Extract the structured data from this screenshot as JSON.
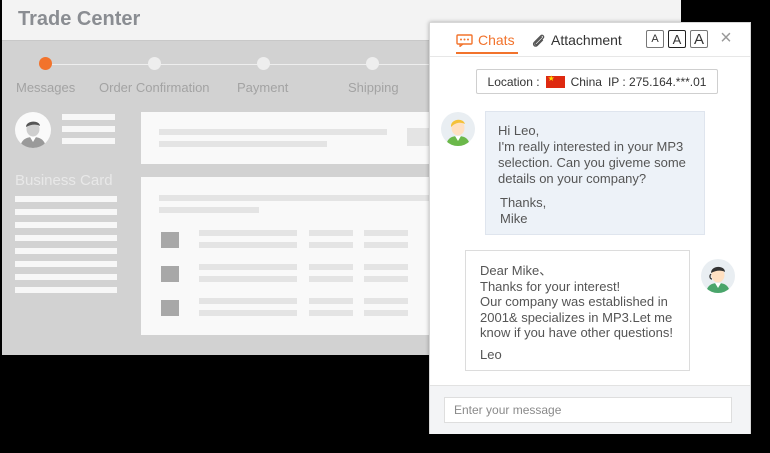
{
  "trade_center": {
    "title": "Trade Center",
    "steps": [
      "Messages",
      "Order Confirmation",
      "Payment",
      "Shipping"
    ],
    "business_card_label": "Business Card"
  },
  "chat": {
    "tabs": {
      "chats": "Chats",
      "attachment": "Attachment"
    },
    "font_sizes": [
      "A",
      "A",
      "A"
    ],
    "close_icon": "close-icon",
    "location": {
      "label": "Location :",
      "country": "China",
      "ip": "IP : 275.164.***.01"
    },
    "incoming_message": [
      "Hi Leo,",
      "I'm really interested in your MP3",
      "selection. Can you giveme some",
      "details on your company?",
      "",
      "Thanks,",
      "Mike"
    ],
    "outgoing_message": [
      "Dear Mike、",
      "Thanks for your interest!",
      "Our company was established in",
      "2001& specializes in MP3.Let me",
      "know if you have other questions!",
      "",
      "Leo"
    ],
    "input_placeholder": "Enter your message"
  },
  "colors": {
    "accent": "#f2732c",
    "bubble_in": "#edf2f8",
    "overlay": "#d2d2d2"
  }
}
